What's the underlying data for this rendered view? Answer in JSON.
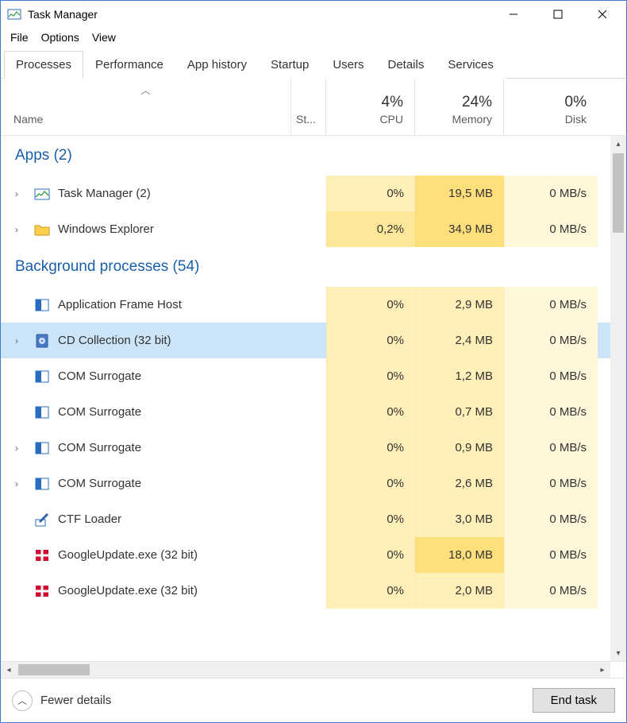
{
  "window": {
    "title": "Task Manager"
  },
  "menu": {
    "file": "File",
    "options": "Options",
    "view": "View"
  },
  "tabs": {
    "processes": "Processes",
    "performance": "Performance",
    "app_history": "App history",
    "startup": "Startup",
    "users": "Users",
    "details": "Details",
    "services": "Services"
  },
  "columns": {
    "name": "Name",
    "status": "St...",
    "cpu_pct": "4%",
    "cpu_label": "CPU",
    "mem_pct": "24%",
    "mem_label": "Memory",
    "disk_pct": "0%",
    "disk_label": "Disk"
  },
  "groups": {
    "apps": "Apps (2)",
    "background": "Background processes (54)"
  },
  "rows": [
    {
      "expand": true,
      "icon": "taskmgr",
      "name": "Task Manager (2)",
      "cpu": "0%",
      "mem": "19,5 MB",
      "disk": "0 MB/s",
      "cpu_h": 1,
      "mem_h": 3,
      "disk_h": 0,
      "group": "apps"
    },
    {
      "expand": true,
      "icon": "folder",
      "name": "Windows Explorer",
      "cpu": "0,2%",
      "mem": "34,9 MB",
      "disk": "0 MB/s",
      "cpu_h": 2,
      "mem_h": 3,
      "disk_h": 0,
      "group": "apps"
    },
    {
      "expand": false,
      "icon": "winapp",
      "name": "Application Frame Host",
      "cpu": "0%",
      "mem": "2,9 MB",
      "disk": "0 MB/s",
      "cpu_h": 1,
      "mem_h": 1,
      "disk_h": 0,
      "group": "bg"
    },
    {
      "expand": true,
      "icon": "cd",
      "name": "CD Collection (32 bit)",
      "cpu": "0%",
      "mem": "2,4 MB",
      "disk": "0 MB/s",
      "cpu_h": 1,
      "mem_h": 1,
      "disk_h": 0,
      "group": "bg",
      "selected": true
    },
    {
      "expand": false,
      "icon": "winapp",
      "name": "COM Surrogate",
      "cpu": "0%",
      "mem": "1,2 MB",
      "disk": "0 MB/s",
      "cpu_h": 1,
      "mem_h": 1,
      "disk_h": 0,
      "group": "bg"
    },
    {
      "expand": false,
      "icon": "winapp",
      "name": "COM Surrogate",
      "cpu": "0%",
      "mem": "0,7 MB",
      "disk": "0 MB/s",
      "cpu_h": 1,
      "mem_h": 1,
      "disk_h": 0,
      "group": "bg"
    },
    {
      "expand": true,
      "icon": "winapp",
      "name": "COM Surrogate",
      "cpu": "0%",
      "mem": "0,9 MB",
      "disk": "0 MB/s",
      "cpu_h": 1,
      "mem_h": 1,
      "disk_h": 0,
      "group": "bg"
    },
    {
      "expand": true,
      "icon": "winapp",
      "name": "COM Surrogate",
      "cpu": "0%",
      "mem": "2,6 MB",
      "disk": "0 MB/s",
      "cpu_h": 1,
      "mem_h": 1,
      "disk_h": 0,
      "group": "bg"
    },
    {
      "expand": false,
      "icon": "ctf",
      "name": "CTF Loader",
      "cpu": "0%",
      "mem": "3,0 MB",
      "disk": "0 MB/s",
      "cpu_h": 1,
      "mem_h": 1,
      "disk_h": 0,
      "group": "bg"
    },
    {
      "expand": false,
      "icon": "dk",
      "name": "GoogleUpdate.exe (32 bit)",
      "cpu": "0%",
      "mem": "18,0 MB",
      "disk": "0 MB/s",
      "cpu_h": 1,
      "mem_h": 3,
      "disk_h": 0,
      "group": "bg"
    },
    {
      "expand": false,
      "icon": "dk",
      "name": "GoogleUpdate.exe (32 bit)",
      "cpu": "0%",
      "mem": "2,0 MB",
      "disk": "0 MB/s",
      "cpu_h": 1,
      "mem_h": 1,
      "disk_h": 0,
      "group": "bg"
    }
  ],
  "footer": {
    "fewer": "Fewer details",
    "end_task": "End task"
  }
}
